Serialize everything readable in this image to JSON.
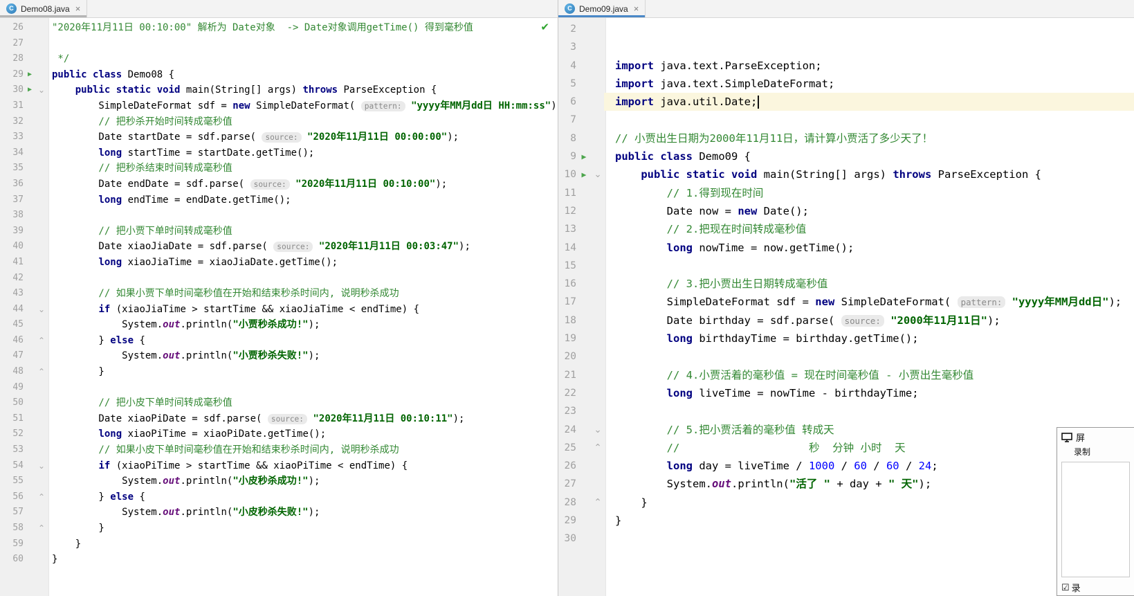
{
  "colors": {
    "kw": "#000080",
    "str": "#006400",
    "com": "#338833",
    "num": "#0000FF",
    "fld": "#660E7A",
    "hint_text": "#8A8A8A",
    "hint_bg": "#EAEAEA",
    "gutter_bg": "#F0F0F0",
    "ln": "#A0A0A0",
    "current_line": "#FBF6DE",
    "run": "#4CA54C",
    "fold": "#ABABAB",
    "divider": "#C8C8C8",
    "tabbar_bg": "#F3F3F3",
    "tabbar_border": "#D6D6D6",
    "editor_bg": "#FFFFFF",
    "tab_active": "#4A88C7",
    "tab_inactive": "#B5B5B5"
  },
  "icons": {
    "close": "×",
    "class_letter": "C",
    "run": "▶",
    "fold_down": "⌄",
    "fold_up": "⌃",
    "check": "✔",
    "checkbox": "☑"
  },
  "left_pane": {
    "tab": {
      "title": "Demo08.java"
    },
    "lines": [
      {
        "n": 26,
        "t": [
          [
            "com",
            "\"2020年11月11日 00:10:00\" 解析为 Date对象  -> Date对象调用getTime() 得到毫秒值"
          ]
        ]
      },
      {
        "n": 27,
        "t": []
      },
      {
        "n": 28,
        "t": [
          [
            "com",
            " */"
          ]
        ]
      },
      {
        "n": 29,
        "run": true,
        "t": [
          [
            "kw",
            "public"
          ],
          [
            "p",
            " "
          ],
          [
            "kw",
            "class"
          ],
          [
            "p",
            " Demo08 {"
          ]
        ]
      },
      {
        "n": 30,
        "run": true,
        "fold": "down",
        "t": [
          [
            "p",
            "    "
          ],
          [
            "kw",
            "public"
          ],
          [
            "p",
            " "
          ],
          [
            "kw",
            "static"
          ],
          [
            "p",
            " "
          ],
          [
            "kw",
            "void"
          ],
          [
            "p",
            " main(String[] args) "
          ],
          [
            "kw",
            "throws"
          ],
          [
            "p",
            " ParseException {"
          ]
        ]
      },
      {
        "n": 31,
        "t": [
          [
            "p",
            "        SimpleDateFormat sdf = "
          ],
          [
            "kw",
            "new"
          ],
          [
            "p",
            " SimpleDateFormat( "
          ],
          [
            "hint",
            "pattern:"
          ],
          [
            "p",
            " "
          ],
          [
            "str",
            "\"yyyy年MM月dd日 HH:mm:ss\""
          ],
          [
            "p",
            ");"
          ]
        ]
      },
      {
        "n": 32,
        "t": [
          [
            "com",
            "        // 把秒杀开始时间转成毫秒值"
          ]
        ]
      },
      {
        "n": 33,
        "t": [
          [
            "p",
            "        Date startDate = sdf.parse( "
          ],
          [
            "hint",
            "source:"
          ],
          [
            "p",
            " "
          ],
          [
            "str",
            "\"2020年11月11日 00:00:00\""
          ],
          [
            "p",
            ");"
          ]
        ]
      },
      {
        "n": 34,
        "t": [
          [
            "p",
            "        "
          ],
          [
            "kw",
            "long"
          ],
          [
            "p",
            " startTime = startDate.getTime();"
          ]
        ]
      },
      {
        "n": 35,
        "t": [
          [
            "com",
            "        // 把秒杀结束时间转成毫秒值"
          ]
        ]
      },
      {
        "n": 36,
        "t": [
          [
            "p",
            "        Date endDate = sdf.parse( "
          ],
          [
            "hint",
            "source:"
          ],
          [
            "p",
            " "
          ],
          [
            "str",
            "\"2020年11月11日 00:10:00\""
          ],
          [
            "p",
            ");"
          ]
        ]
      },
      {
        "n": 37,
        "t": [
          [
            "p",
            "        "
          ],
          [
            "kw",
            "long"
          ],
          [
            "p",
            " endTime = endDate.getTime();"
          ]
        ]
      },
      {
        "n": 38,
        "t": []
      },
      {
        "n": 39,
        "t": [
          [
            "com",
            "        // 把小贾下单时间转成毫秒值"
          ]
        ]
      },
      {
        "n": 40,
        "t": [
          [
            "p",
            "        Date xiaoJiaDate = sdf.parse( "
          ],
          [
            "hint",
            "source:"
          ],
          [
            "p",
            " "
          ],
          [
            "str",
            "\"2020年11月11日 00:03:47\""
          ],
          [
            "p",
            ");"
          ]
        ]
      },
      {
        "n": 41,
        "t": [
          [
            "p",
            "        "
          ],
          [
            "kw",
            "long"
          ],
          [
            "p",
            " xiaoJiaTime = xiaoJiaDate.getTime();"
          ]
        ]
      },
      {
        "n": 42,
        "t": []
      },
      {
        "n": 43,
        "t": [
          [
            "com",
            "        // 如果小贾下单时间毫秒值在开始和结束秒杀时间内, 说明秒杀成功"
          ]
        ]
      },
      {
        "n": 44,
        "fold": "down",
        "t": [
          [
            "p",
            "        "
          ],
          [
            "kw",
            "if"
          ],
          [
            "p",
            " (xiaoJiaTime > startTime && xiaoJiaTime < endTime) {"
          ]
        ]
      },
      {
        "n": 45,
        "t": [
          [
            "p",
            "            System."
          ],
          [
            "fld",
            "out"
          ],
          [
            "p",
            ".println("
          ],
          [
            "str",
            "\"小贾秒杀成功!\""
          ],
          [
            "p",
            ");"
          ]
        ]
      },
      {
        "n": 46,
        "fold": "up",
        "t": [
          [
            "p",
            "        } "
          ],
          [
            "kw",
            "else"
          ],
          [
            "p",
            " {"
          ]
        ]
      },
      {
        "n": 47,
        "t": [
          [
            "p",
            "            System."
          ],
          [
            "fld",
            "out"
          ],
          [
            "p",
            ".println("
          ],
          [
            "str",
            "\"小贾秒杀失败!\""
          ],
          [
            "p",
            ");"
          ]
        ]
      },
      {
        "n": 48,
        "fold": "up",
        "t": [
          [
            "p",
            "        }"
          ]
        ]
      },
      {
        "n": 49,
        "t": []
      },
      {
        "n": 50,
        "t": [
          [
            "com",
            "        // 把小皮下单时间转成毫秒值"
          ]
        ]
      },
      {
        "n": 51,
        "t": [
          [
            "p",
            "        Date xiaoPiDate = sdf.parse( "
          ],
          [
            "hint",
            "source:"
          ],
          [
            "p",
            " "
          ],
          [
            "str",
            "\"2020年11月11日 00:10:11\""
          ],
          [
            "p",
            ");"
          ]
        ]
      },
      {
        "n": 52,
        "t": [
          [
            "p",
            "        "
          ],
          [
            "kw",
            "long"
          ],
          [
            "p",
            " xiaoPiTime = xiaoPiDate.getTime();"
          ]
        ]
      },
      {
        "n": 53,
        "t": [
          [
            "com",
            "        // 如果小皮下单时间毫秒值在开始和结束秒杀时间内, 说明秒杀成功"
          ]
        ]
      },
      {
        "n": 54,
        "fold": "down",
        "t": [
          [
            "p",
            "        "
          ],
          [
            "kw",
            "if"
          ],
          [
            "p",
            " (xiaoPiTime > startTime && xiaoPiTime < endTime) {"
          ]
        ]
      },
      {
        "n": 55,
        "t": [
          [
            "p",
            "            System."
          ],
          [
            "fld",
            "out"
          ],
          [
            "p",
            ".println("
          ],
          [
            "str",
            "\"小皮秒杀成功!\""
          ],
          [
            "p",
            ");"
          ]
        ]
      },
      {
        "n": 56,
        "fold": "up",
        "t": [
          [
            "p",
            "        } "
          ],
          [
            "kw",
            "else"
          ],
          [
            "p",
            " {"
          ]
        ]
      },
      {
        "n": 57,
        "t": [
          [
            "p",
            "            System."
          ],
          [
            "fld",
            "out"
          ],
          [
            "p",
            ".println("
          ],
          [
            "str",
            "\"小皮秒杀失败!\""
          ],
          [
            "p",
            ");"
          ]
        ]
      },
      {
        "n": 58,
        "fold": "up",
        "t": [
          [
            "p",
            "        }"
          ]
        ]
      },
      {
        "n": 59,
        "t": [
          [
            "p",
            "    }"
          ]
        ]
      },
      {
        "n": 60,
        "t": [
          [
            "p",
            "}"
          ]
        ]
      }
    ]
  },
  "right_pane": {
    "tab": {
      "title": "Demo09.java"
    },
    "lines": [
      {
        "n": 2,
        "t": []
      },
      {
        "n": 3,
        "t": []
      },
      {
        "n": 4,
        "t": [
          [
            "kw",
            "import"
          ],
          [
            "p",
            " java.text.ParseException;"
          ]
        ]
      },
      {
        "n": 5,
        "t": [
          [
            "kw",
            "import"
          ],
          [
            "p",
            " java.text.SimpleDateFormat;"
          ]
        ]
      },
      {
        "n": 6,
        "current": true,
        "t": [
          [
            "kw",
            "import"
          ],
          [
            "p",
            " java.util.Date;"
          ],
          [
            "cursor",
            ""
          ]
        ]
      },
      {
        "n": 7,
        "t": []
      },
      {
        "n": 8,
        "t": [
          [
            "com",
            "// 小贾出生日期为2000年11月11日，请计算小贾活了多少天了！"
          ]
        ]
      },
      {
        "n": 9,
        "run": true,
        "t": [
          [
            "kw",
            "public"
          ],
          [
            "p",
            " "
          ],
          [
            "kw",
            "class"
          ],
          [
            "p",
            " Demo09 {"
          ]
        ]
      },
      {
        "n": 10,
        "run": true,
        "fold": "down",
        "t": [
          [
            "p",
            "    "
          ],
          [
            "kw",
            "public"
          ],
          [
            "p",
            " "
          ],
          [
            "kw",
            "static"
          ],
          [
            "p",
            " "
          ],
          [
            "kw",
            "void"
          ],
          [
            "p",
            " main(String[] args) "
          ],
          [
            "kw",
            "throws"
          ],
          [
            "p",
            " ParseException {"
          ]
        ]
      },
      {
        "n": 11,
        "t": [
          [
            "com",
            "        // 1.得到现在时间"
          ]
        ]
      },
      {
        "n": 12,
        "t": [
          [
            "p",
            "        Date now = "
          ],
          [
            "kw",
            "new"
          ],
          [
            "p",
            " Date();"
          ]
        ]
      },
      {
        "n": 13,
        "t": [
          [
            "com",
            "        // 2.把现在时间转成毫秒值"
          ]
        ]
      },
      {
        "n": 14,
        "t": [
          [
            "p",
            "        "
          ],
          [
            "kw",
            "long"
          ],
          [
            "p",
            " nowTime = now.getTime();"
          ]
        ]
      },
      {
        "n": 15,
        "t": []
      },
      {
        "n": 16,
        "t": [
          [
            "com",
            "        // 3.把小贾出生日期转成毫秒值"
          ]
        ]
      },
      {
        "n": 17,
        "t": [
          [
            "p",
            "        SimpleDateFormat sdf = "
          ],
          [
            "kw",
            "new"
          ],
          [
            "p",
            " SimpleDateFormat( "
          ],
          [
            "hint",
            "pattern:"
          ],
          [
            "p",
            " "
          ],
          [
            "str",
            "\"yyyy年MM月dd日\""
          ],
          [
            "p",
            ");"
          ]
        ]
      },
      {
        "n": 18,
        "t": [
          [
            "p",
            "        Date birthday = sdf.parse( "
          ],
          [
            "hint",
            "source:"
          ],
          [
            "p",
            " "
          ],
          [
            "str",
            "\"2000年11月11日\""
          ],
          [
            "p",
            ");"
          ]
        ]
      },
      {
        "n": 19,
        "t": [
          [
            "p",
            "        "
          ],
          [
            "kw",
            "long"
          ],
          [
            "p",
            " birthdayTime = birthday.getTime();"
          ]
        ]
      },
      {
        "n": 20,
        "t": []
      },
      {
        "n": 21,
        "t": [
          [
            "com",
            "        // 4.小贾活着的毫秒值 = 现在时间毫秒值 - 小贾出生毫秒值"
          ]
        ]
      },
      {
        "n": 22,
        "t": [
          [
            "p",
            "        "
          ],
          [
            "kw",
            "long"
          ],
          [
            "p",
            " liveTime = nowTime - birthdayTime;"
          ]
        ]
      },
      {
        "n": 23,
        "t": []
      },
      {
        "n": 24,
        "fold": "down",
        "t": [
          [
            "com",
            "        // 5.把小贾活着的毫秒值 转成天"
          ]
        ]
      },
      {
        "n": 25,
        "fold": "up",
        "t": [
          [
            "com",
            "        //                    秒  分钟 小时  天"
          ]
        ]
      },
      {
        "n": 26,
        "t": [
          [
            "p",
            "        "
          ],
          [
            "kw",
            "long"
          ],
          [
            "p",
            " day = liveTime / "
          ],
          [
            "num",
            "1000"
          ],
          [
            "p",
            " / "
          ],
          [
            "num",
            "60"
          ],
          [
            "p",
            " / "
          ],
          [
            "num",
            "60"
          ],
          [
            "p",
            " / "
          ],
          [
            "num",
            "24"
          ],
          [
            "p",
            ";"
          ]
        ]
      },
      {
        "n": 27,
        "t": [
          [
            "p",
            "        System."
          ],
          [
            "fld",
            "out"
          ],
          [
            "p",
            ".println("
          ],
          [
            "str",
            "\"活了 \""
          ],
          [
            "p",
            " + day + "
          ],
          [
            "str",
            "\" 天\""
          ],
          [
            "p",
            ");"
          ]
        ]
      },
      {
        "n": 28,
        "fold": "up",
        "t": [
          [
            "p",
            "    }"
          ]
        ]
      },
      {
        "n": 29,
        "t": [
          [
            "p",
            "}"
          ]
        ]
      },
      {
        "n": 30,
        "t": []
      }
    ]
  },
  "overlay": {
    "screen_label": "屏",
    "record_label": "录制",
    "checkbox_label": "录"
  }
}
